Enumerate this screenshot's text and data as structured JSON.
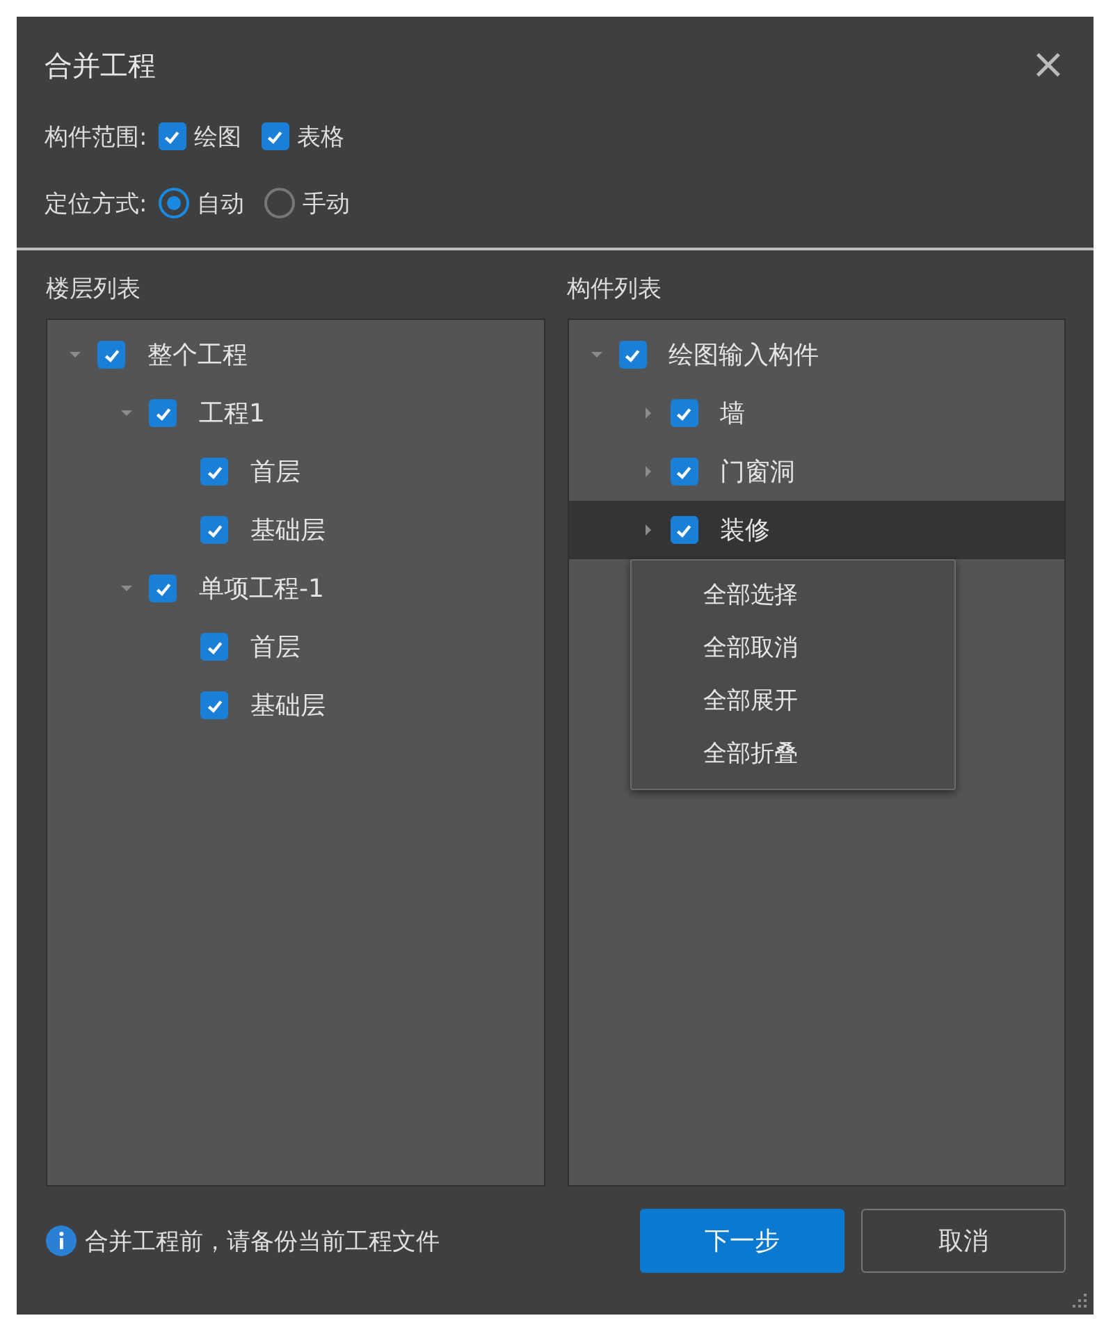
{
  "window": {
    "title": "合并工程",
    "close": "×"
  },
  "scope": {
    "label": "构件范围:",
    "options": [
      {
        "label": "绘图",
        "checked": true
      },
      {
        "label": "表格",
        "checked": true
      }
    ]
  },
  "positioning": {
    "label": "定位方式:",
    "options": [
      {
        "label": "自动",
        "selected": true
      },
      {
        "label": "手动",
        "selected": false
      }
    ]
  },
  "floor_list": {
    "title": "楼层列表",
    "tree": [
      {
        "label": "整个工程",
        "checked": true,
        "expanded": true,
        "selected": false,
        "children": [
          {
            "label": "工程1",
            "checked": true,
            "expanded": true,
            "selected": false,
            "children": [
              {
                "label": "首层",
                "checked": true,
                "selected": false
              },
              {
                "label": "基础层",
                "checked": true,
                "selected": false
              }
            ]
          },
          {
            "label": "单项工程-1",
            "checked": true,
            "expanded": true,
            "selected": false,
            "children": [
              {
                "label": "首层",
                "checked": true,
                "selected": false
              },
              {
                "label": "基础层",
                "checked": true,
                "selected": false
              }
            ]
          }
        ]
      }
    ]
  },
  "component_list": {
    "title": "构件列表",
    "tree": [
      {
        "label": "绘图输入构件",
        "checked": true,
        "expanded": true,
        "selected": false,
        "children": [
          {
            "label": "墙",
            "checked": true,
            "expanded": false,
            "selected": false
          },
          {
            "label": "门窗洞",
            "checked": true,
            "expanded": false,
            "selected": false
          },
          {
            "label": "装修",
            "checked": true,
            "expanded": false,
            "selected": true
          }
        ]
      }
    ],
    "context_menu": [
      "全部选择",
      "全部取消",
      "全部展开",
      "全部折叠"
    ]
  },
  "footer": {
    "note": "合并工程前，请备份当前工程文件",
    "buttons": [
      {
        "label": "下一步",
        "kind": "primary"
      },
      {
        "label": "取消",
        "kind": "secondary"
      }
    ]
  }
}
